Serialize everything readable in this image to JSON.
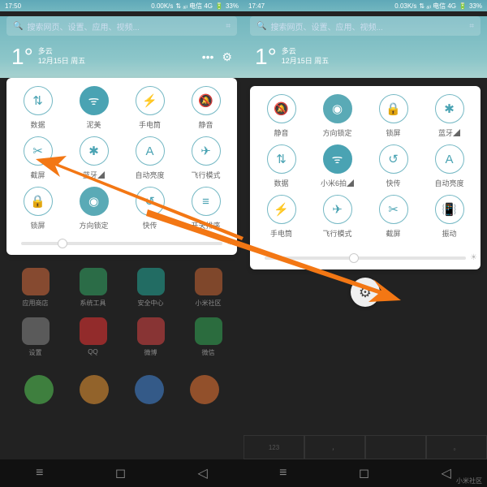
{
  "left": {
    "status": {
      "time": "17:50",
      "net": "0.00K/s",
      "sig": "⇅ ₐᵢₗ 电信 4G",
      "bat": "33%"
    },
    "search": {
      "placeholder": "搜索网页、设置、应用、视频..."
    },
    "weather": {
      "temp": "1°",
      "cond": "多云",
      "date": "12月15日 周五",
      "more": "•••",
      "gear": "⚙"
    },
    "toggles": [
      {
        "label": "数据",
        "icon": "⇅",
        "on": false
      },
      {
        "label": "泥美",
        "icon": "wifi",
        "on": true
      },
      {
        "label": "手电筒",
        "icon": "⚡",
        "on": false
      },
      {
        "label": "静音",
        "icon": "🔕",
        "on": false
      },
      {
        "label": "截屏",
        "icon": "✂",
        "on": false
      },
      {
        "label": "蓝牙◢",
        "icon": "✱",
        "on": false
      },
      {
        "label": "自动亮度",
        "icon": "A",
        "on": false
      },
      {
        "label": "飞行模式",
        "icon": "✈",
        "on": false
      },
      {
        "label": "锁屏",
        "icon": "🔒",
        "on": false
      },
      {
        "label": "方向锁定",
        "icon": "◉",
        "on": true
      },
      {
        "label": "快传",
        "icon": "↺",
        "on": false
      },
      {
        "label": "开关排序",
        "icon": "≡",
        "on": false
      }
    ],
    "brightness": 18,
    "apps": [
      {
        "label": "应用商店",
        "c": "#d96c3c"
      },
      {
        "label": "系统工具",
        "c": "#3a6"
      },
      {
        "label": "安全中心",
        "c": "#2a9"
      },
      {
        "label": "小米社区",
        "c": "#c63"
      },
      {
        "label": "设置",
        "c": "#888"
      },
      {
        "label": "QQ",
        "c": "#e33"
      },
      {
        "label": "微博",
        "c": "#d44"
      },
      {
        "label": "微信",
        "c": "#3a5"
      }
    ],
    "dock": [
      "#5c5",
      "#e93",
      "#48d",
      "#e73"
    ]
  },
  "right": {
    "status": {
      "time": "17:47",
      "net": "0.03K/s",
      "sig": "⇅ ₐᵢₗ 电信 4G",
      "bat": "33%"
    },
    "search": {
      "placeholder": "搜索网页、设置、应用、视频..."
    },
    "weather": {
      "temp": "1°",
      "cond": "多云",
      "date": "12月15日 周五"
    },
    "toggles": [
      {
        "label": "静音",
        "icon": "🔕",
        "on": false
      },
      {
        "label": "方向锁定",
        "icon": "◉",
        "on": true
      },
      {
        "label": "锁屏",
        "icon": "🔒",
        "on": false
      },
      {
        "label": "蓝牙◢",
        "icon": "✱",
        "on": false
      },
      {
        "label": "数据",
        "icon": "⇅",
        "on": false
      },
      {
        "label": "小米6拍◢",
        "icon": "wifi",
        "on": true
      },
      {
        "label": "快传",
        "icon": "↺",
        "on": false
      },
      {
        "label": "自动亮度",
        "icon": "A",
        "on": false
      },
      {
        "label": "手电筒",
        "icon": "⚡",
        "on": false
      },
      {
        "label": "飞行模式",
        "icon": "✈",
        "on": false
      },
      {
        "label": "截屏",
        "icon": "✂",
        "on": false
      },
      {
        "label": "振动",
        "icon": "📳",
        "on": false
      }
    ],
    "brightness": 42,
    "kbd": [
      "123",
      "，",
      "　",
      "。"
    ],
    "credit": "小米社区"
  }
}
